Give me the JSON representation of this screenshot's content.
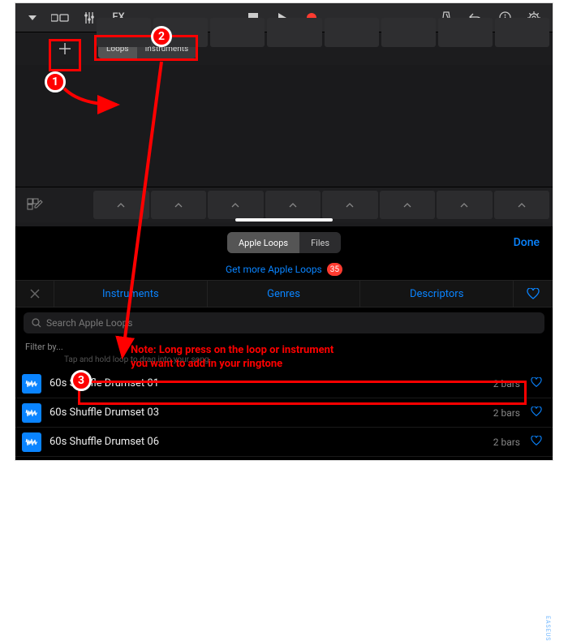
{
  "toolbar": {
    "fx_label": "FX"
  },
  "sub": {
    "loops_label": "Loops",
    "instruments_label": "Instruments"
  },
  "browser": {
    "seg_apple": "Apple Loops",
    "seg_files": "Files",
    "done": "Done",
    "get_more": "Get more Apple Loops",
    "get_more_badge": "35",
    "filter_instruments": "Instruments",
    "filter_genres": "Genres",
    "filter_descriptors": "Descriptors",
    "search_placeholder": "Search Apple Loops",
    "filter_by": "Filter by...",
    "hint": "Tap and hold loop to drag into your song."
  },
  "loops": [
    {
      "name": "60s Shuffle Drumset 01",
      "bars": "2 bars"
    },
    {
      "name": "60s Shuffle Drumset 03",
      "bars": "2 bars"
    },
    {
      "name": "60s Shuffle Drumset 06",
      "bars": "2 bars"
    }
  ],
  "annotations": {
    "step1": "1",
    "step2": "2",
    "step3": "3",
    "note_line1": "Note: Long press on the loop or instrument",
    "note_line2": "you want to add in your ringtone"
  }
}
